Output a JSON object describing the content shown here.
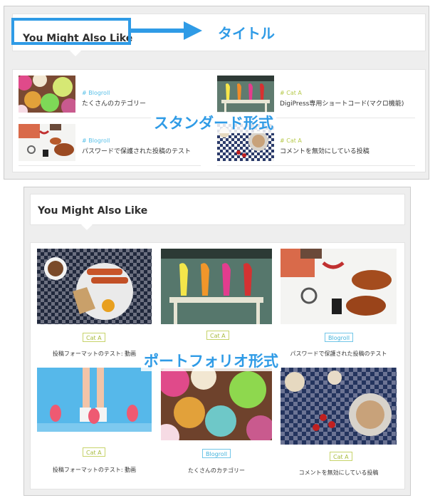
{
  "standard": {
    "heading": "You Might Also Like",
    "items": [
      {
        "category": "# Blogroll",
        "title": "たくさんのカテゴリー",
        "category_type": "blogroll"
      },
      {
        "category": "# Cat A",
        "title": "DigiPress専用ショートコード(マクロ機能)",
        "category_type": "cat-a"
      },
      {
        "category": "# Blogroll",
        "title": "パスワードで保護された投稿のテスト",
        "category_type": "blogroll"
      },
      {
        "category": "# Cat A",
        "title": "コメントを無効にしている投稿",
        "category_type": "cat-a"
      }
    ]
  },
  "portfolio": {
    "heading": "You Might Also Like",
    "items": [
      {
        "category": "Cat A",
        "title": "投稿フォーマットのテスト: 動画"
      },
      {
        "category": "Cat A",
        "title": ""
      },
      {
        "category": "Blogroll",
        "title": "パスワードで保護された投稿のテスト"
      },
      {
        "category": "Cat A",
        "title": "投稿フォーマットのテスト: 動画"
      },
      {
        "category": "Blogroll",
        "title": "たくさんのカテゴリー"
      },
      {
        "category": "Cat A",
        "title": "コメントを無効にしている投稿"
      }
    ]
  },
  "annotations": {
    "title_label": "タイトル",
    "standard_label": "スタンダード形式",
    "portfolio_label": "ポートフォリオ形式"
  },
  "colors": {
    "accent_blue": "#2f9be6",
    "blogroll": "#58c0e8",
    "cat_a": "#b6c94b"
  }
}
